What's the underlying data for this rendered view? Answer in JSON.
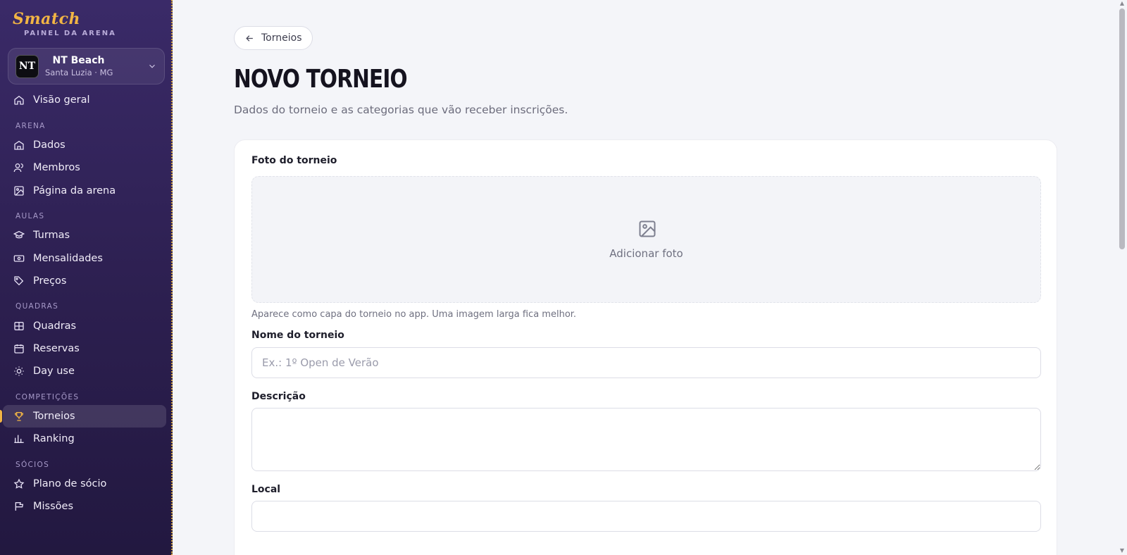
{
  "brand": {
    "logo": "Smatch",
    "subtitle": "PAINEL DA ARENA"
  },
  "arena": {
    "avatar_text": "NT",
    "name": "NT Beach",
    "location": "Santa Luzia · MG"
  },
  "nav": {
    "overview": "Visão geral",
    "sections": {
      "arena": "ARENA",
      "aulas": "AULAS",
      "quadras": "QUADRAS",
      "competicoes": "COMPETIÇÕES",
      "socios": "SÓCIOS"
    },
    "items": {
      "dados": "Dados",
      "membros": "Membros",
      "pagina": "Página da arena",
      "turmas": "Turmas",
      "mensalidades": "Mensalidades",
      "precos": "Preços",
      "quadras": "Quadras",
      "reservas": "Reservas",
      "dayuse": "Day use",
      "torneios": "Torneios",
      "ranking": "Ranking",
      "plano": "Plano de sócio",
      "missoes": "Missões"
    },
    "active": "torneios"
  },
  "main": {
    "back_label": "Torneios",
    "title": "NOVO TORNEIO",
    "subtitle": "Dados do torneio e as categorias que vão receber inscrições.",
    "form": {
      "photo_label": "Foto do torneio",
      "photo_add": "Adicionar foto",
      "photo_hint": "Aparece como capa do torneio no app. Uma imagem larga fica melhor.",
      "name_label": "Nome do torneio",
      "name_placeholder": "Ex.: 1º Open de Verão",
      "name_value": "",
      "description_label": "Descrição",
      "description_value": "",
      "local_label": "Local",
      "local_value": ""
    }
  },
  "colors": {
    "accent": "#f2b544",
    "sidebar": "#2c1f4f",
    "background": "#f4f5f9"
  }
}
